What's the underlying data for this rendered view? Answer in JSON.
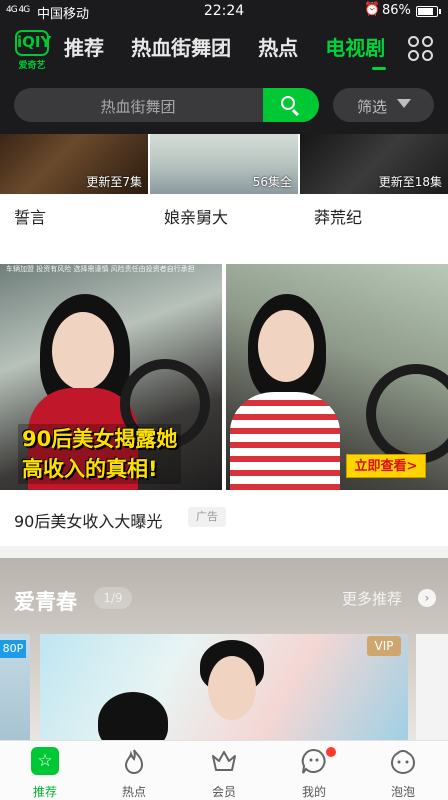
{
  "status_bar": {
    "signal": "4G 4G",
    "carrier": "中国移动",
    "time": "22:24",
    "battery": "86%"
  },
  "app": {
    "logo_text": "爱奇艺",
    "brand_color": "#00c835"
  },
  "nav": {
    "tabs": [
      "推荐",
      "热血街舞团",
      "热点",
      "电视剧"
    ],
    "active_tab": "电视剧"
  },
  "search": {
    "placeholder": "热血街舞团",
    "filter_label": "筛选"
  },
  "dramas": [
    {
      "title": "誓言",
      "badge": "更新至7集"
    },
    {
      "title": "娘亲舅大",
      "badge": "56集全"
    },
    {
      "title": "莽荒纪",
      "badge": "更新至18集"
    }
  ],
  "ad": {
    "top_line": "车辆加盟 投资有风险 选择需谨慎 风险责任由投资者自行承担",
    "caption_line1": "90后美女揭露她",
    "caption_line2": "高收入的真相!",
    "cta": "立即查看>",
    "title": "90后美女收入大曝光",
    "tag": "广告"
  },
  "section": {
    "title": "爱青春",
    "page": "1/9",
    "more": "更多推荐",
    "left_tag": "80P",
    "vip_badge": "VIP"
  },
  "bottom_nav": [
    {
      "label": "推荐",
      "icon": "star-icon",
      "active": true
    },
    {
      "label": "热点",
      "icon": "flame-icon",
      "active": false
    },
    {
      "label": "会员",
      "icon": "crown-icon",
      "active": false
    },
    {
      "label": "我的",
      "icon": "face-icon",
      "active": false
    },
    {
      "label": "泡泡",
      "icon": "bubble-icon",
      "active": false
    }
  ]
}
